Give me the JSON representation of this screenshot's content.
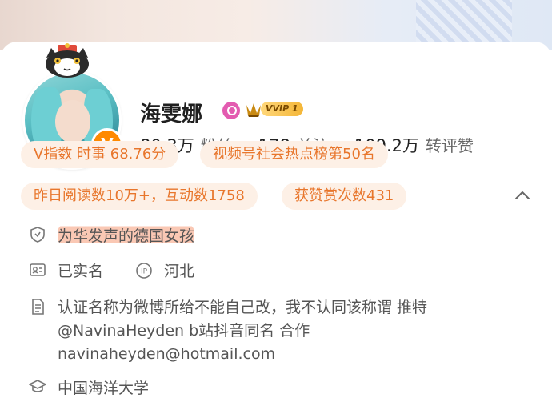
{
  "profile": {
    "name": "海雯娜",
    "vip_label": "VVIP 1",
    "verified_badge": "V"
  },
  "stats": [
    {
      "num": "80.3万",
      "label": "粉丝"
    },
    {
      "num": "178",
      "label": "关注"
    },
    {
      "num": "109.2万",
      "label": "转评赞"
    }
  ],
  "tags": {
    "v_index": "V指数 时事 68.76分",
    "ranking": "视频号社会热点榜第50名",
    "yesterday": "昨日阅读数10万+，互动数1758",
    "rewards": "获赞赏次数431"
  },
  "info": {
    "verification": "为华发声的德国女孩",
    "real_name": "已实名",
    "location": "河北",
    "intro": "认证名称为微博所给不能自己改，我不认同该称谓 推特@NavinaHeyden b站抖音同名 合作navinaheyden@hotmail.com",
    "school": "中国海洋大学"
  },
  "colors": {
    "accent": "#e8762c",
    "tag_bg": "#fdf0e6",
    "badge": "#ff8a00",
    "highlight": "#f8aa8c"
  },
  "icons": [
    "shield-icon",
    "id-card-icon",
    "ip-icon",
    "document-icon",
    "graduation-cap-icon",
    "chevron-up-icon",
    "crown-icon"
  ]
}
